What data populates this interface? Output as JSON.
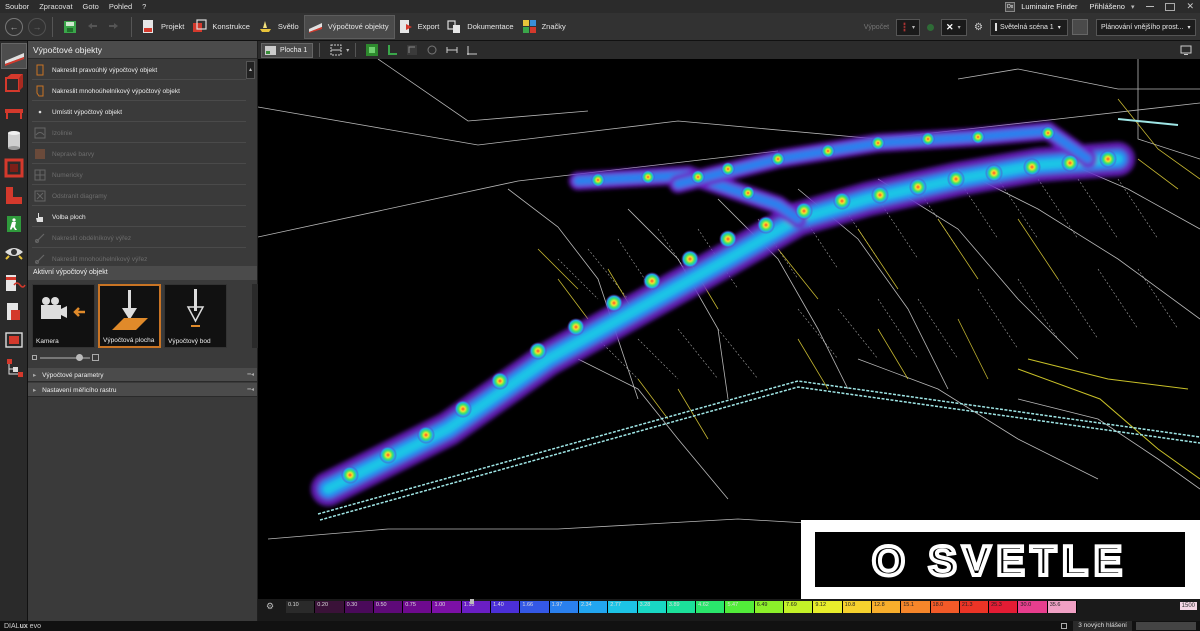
{
  "menu": [
    "Soubor",
    "Zpracovat",
    "Goto",
    "Pohled",
    "?"
  ],
  "top_right": {
    "luminaire_finder": "Luminaire Finder",
    "lf_icon": "Dx",
    "login": "Přihlášeno",
    "login_arrow": "▾"
  },
  "nav": {
    "back_icon": "arrow-left-icon",
    "forward_icon": "arrow-right-icon",
    "back_glyph": "←",
    "forward_glyph": "→"
  },
  "tabs": [
    {
      "label": "Projekt",
      "icon": "project-icon",
      "active": false
    },
    {
      "label": "Konstrukce",
      "icon": "construction-icon",
      "active": false
    },
    {
      "label": "Světlo",
      "icon": "light-icon",
      "active": false
    },
    {
      "label": "Výpočtové objekty",
      "icon": "calc-objects-icon",
      "active": true
    },
    {
      "label": "Export",
      "icon": "export-icon",
      "active": false
    },
    {
      "label": "Dokumentace",
      "icon": "documentation-icon",
      "active": false
    },
    {
      "label": "Značky",
      "icon": "marks-icon",
      "active": false
    }
  ],
  "toolbar_right": {
    "calc_label": "Výpočet",
    "scene": "Světelná scéna 1",
    "planning": "Plánování vnějšího prost..."
  },
  "panel": {
    "title": "Výpočtové objekty",
    "items": [
      {
        "label": "Nakreslit pravoúhlý výpočtový objekt",
        "disabled": false
      },
      {
        "label": "Nakreslit mnohoúhelníkový výpočtový objekt",
        "disabled": false
      },
      {
        "label": "Umístit výpočtový objekt",
        "disabled": false
      },
      {
        "label": "Izolinie",
        "disabled": true
      },
      {
        "label": "Nepravé barvy",
        "disabled": true
      },
      {
        "label": "Numericky",
        "disabled": true
      },
      {
        "label": "Odstranit diagramy",
        "disabled": true
      },
      {
        "label": "Volba ploch",
        "disabled": false
      },
      {
        "label": "Nakreslit obdélníkový výřez",
        "disabled": true
      },
      {
        "label": "Nakreslit mnohoúhelníkový výřez",
        "disabled": true
      }
    ],
    "active_section": "Aktivní výpočtový objekt",
    "tiles": [
      {
        "label": "Kamera",
        "icon": "camera-icon",
        "selected": false
      },
      {
        "label": "Výpočtová plocha",
        "icon": "calc-surface-icon",
        "selected": true
      },
      {
        "label": "Výpočtový bod",
        "icon": "calc-point-icon",
        "selected": false
      }
    ],
    "collapsed": [
      "Výpočtové parametry",
      "Nastavení měřicího rastru"
    ]
  },
  "viewport": {
    "tab": "Plocha 1"
  },
  "logo_text": "O SVETLE",
  "legend": {
    "values": [
      "0.10",
      "0.20",
      "0.30",
      "0.50",
      "0.75",
      "1.00",
      "1.18",
      "1.40",
      "1.66",
      "1.97",
      "2.34",
      "2.77",
      "3.28",
      "3.89",
      "4.62",
      "5.47",
      "6.49",
      "7.69",
      "9.12",
      "10.8",
      "12.8",
      "15.1",
      "18.0",
      "21.3",
      "25.3",
      "30.0",
      "35.6"
    ],
    "colors": [
      "#2a2a2a",
      "#3a1238",
      "#4a0a5a",
      "#5e0a78",
      "#6e0a8e",
      "#7c10a6",
      "#6a1ec4",
      "#4b2fd8",
      "#3458e6",
      "#2a80ee",
      "#22a6f0",
      "#1dc4e6",
      "#19d8c4",
      "#1ce09a",
      "#2ae66c",
      "#52ec3a",
      "#8cf02a",
      "#c4f228",
      "#e8ee2c",
      "#f6d22e",
      "#f8ae2c",
      "#f6862a",
      "#f25a28",
      "#ec3426",
      "#e41c34",
      "#e83e8e",
      "#f0a0c4"
    ],
    "max": "1500"
  },
  "status": {
    "brand_a": "DIAL",
    "brand_b": "ux",
    "brand_c": " evo",
    "notices": "3 nových hlášení"
  }
}
